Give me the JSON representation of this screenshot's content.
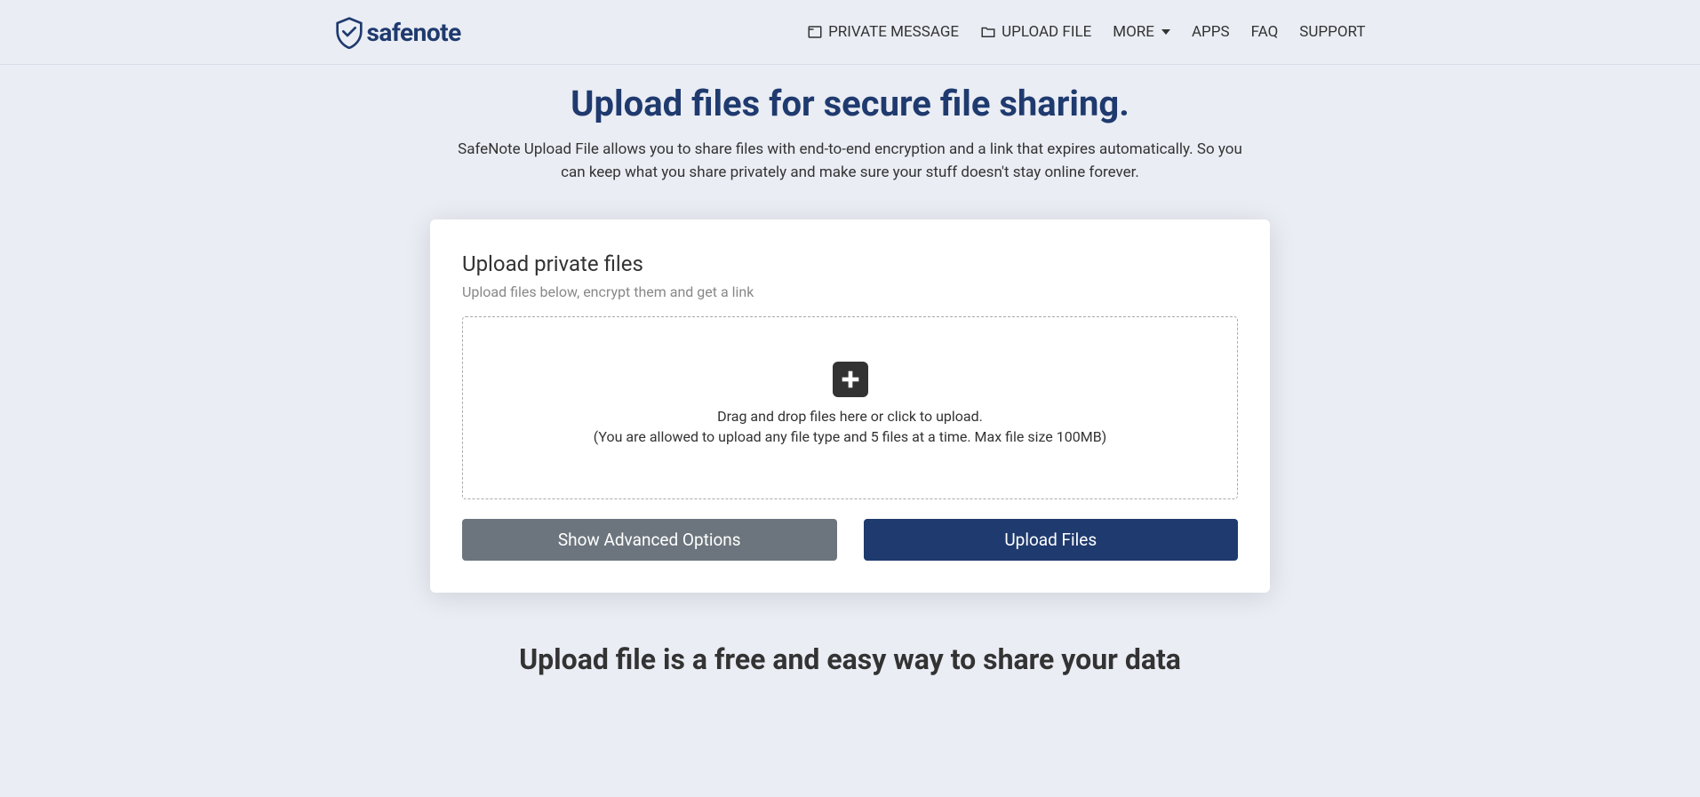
{
  "logo": {
    "text": "safenote"
  },
  "nav": {
    "items": [
      {
        "label": "PRIVATE MESSAGE",
        "icon": "message-icon"
      },
      {
        "label": "UPLOAD FILE",
        "icon": "folder-icon"
      },
      {
        "label": "MORE",
        "icon": null,
        "dropdown": true
      },
      {
        "label": "APPS",
        "icon": null
      },
      {
        "label": "FAQ",
        "icon": null
      },
      {
        "label": "SUPPORT",
        "icon": null
      }
    ]
  },
  "hero": {
    "title": "Upload files for secure file sharing.",
    "subtitle": "SafeNote Upload File allows you to share files with end-to-end encryption and a link that expires automatically. So you can keep what you share privately and make sure your stuff doesn't stay online forever."
  },
  "card": {
    "title": "Upload private files",
    "subtitle": "Upload files below, encrypt them and get a link",
    "dropzone_text": "Drag and drop files here or click to upload.",
    "dropzone_hint": "(You are allowed to upload any file type and 5 files at a time. Max file size 100MB)"
  },
  "buttons": {
    "advanced": "Show Advanced Options",
    "upload": "Upload Files"
  },
  "section": {
    "title": "Upload file is a free and easy way to share your data"
  }
}
